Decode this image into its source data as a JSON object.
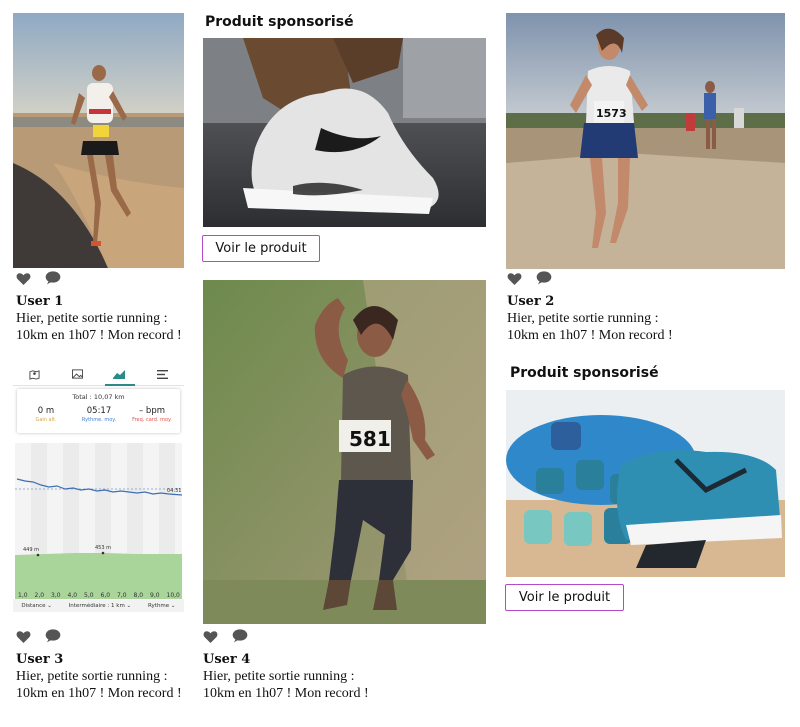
{
  "sponsored": [
    {
      "title": "Produit sponsorisé",
      "button_label": "Voir le produit"
    },
    {
      "title": "Produit sponsorisé",
      "button_label": "Voir le produit"
    }
  ],
  "posts": [
    {
      "user": "User 1",
      "caption_line1": "Hier, petite sortie running :",
      "caption_line2": "10km en 1h07 ! Mon record !",
      "bib": "54"
    },
    {
      "user": "User 2",
      "caption_line1": "Hier, petite sortie running :",
      "caption_line2": "10km en 1h07 ! Mon record !",
      "bib": "1573"
    },
    {
      "user": "User 3",
      "caption_line1": "Hier, petite sortie running :",
      "caption_line2": "10km en 1h07 ! Mon record !"
    },
    {
      "user": "User 4",
      "caption_line1": "Hier, petite sortie running :",
      "caption_line2": "10km en 1h07 ! Mon record !",
      "bib": "581"
    }
  ],
  "icons": {
    "like": "heart-icon",
    "comment": "comment-icon"
  },
  "running_app": {
    "total": "Total : 10,07 km",
    "stats": [
      {
        "value": "0 m",
        "label": "Gain alt.",
        "color": "#d9a441"
      },
      {
        "value": "05:17",
        "label": "Rythme. moy.",
        "color": "#3d7fd1"
      },
      {
        "value": "– bpm",
        "label": "Freq. card. moy.",
        "color": "#e0534a"
      }
    ],
    "pace_label": "04:31",
    "altitude_labels": [
      "449 m",
      "453 m"
    ],
    "x_ticks": [
      "1,0",
      "2,0",
      "3,0",
      "4,0",
      "5,0",
      "6,0",
      "7,0",
      "8,0",
      "9,0",
      "10,0"
    ],
    "footer": [
      "Distance ⌄",
      "Intermédiaire : 1 km ⌄",
      "Rythme ⌄"
    ]
  },
  "colors": {
    "accent_border": "#b34bc8",
    "icon_gray": "#555555",
    "app_teal": "#2c8a8a"
  }
}
